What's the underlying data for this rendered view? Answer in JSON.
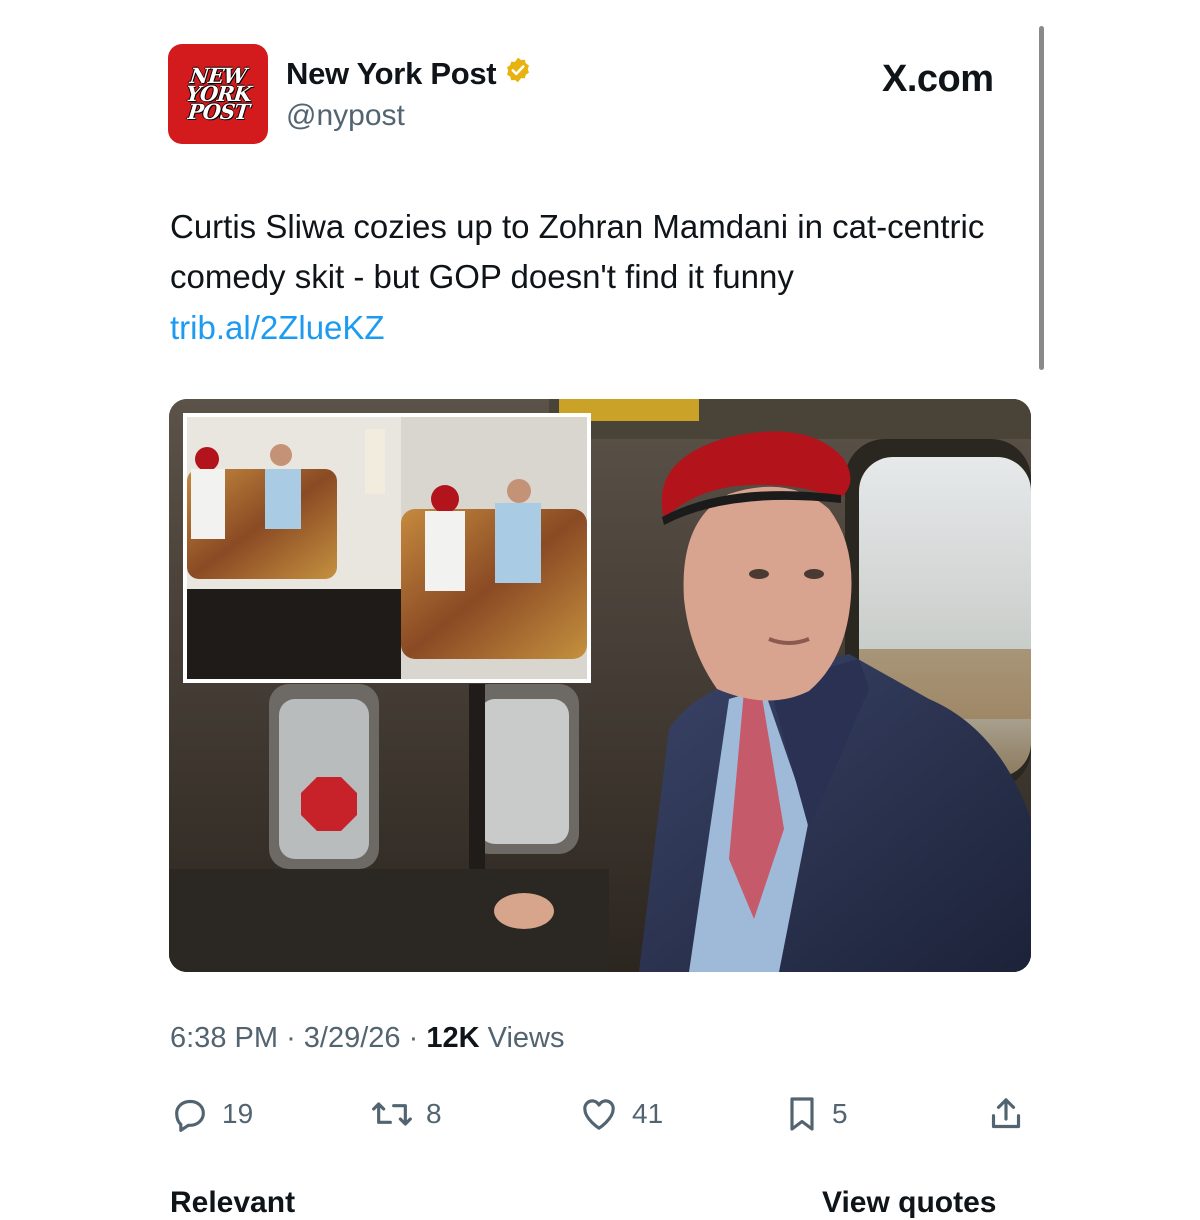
{
  "source_label": "X.com",
  "account": {
    "name": "New York Post",
    "handle": "@nypost",
    "avatar_lines": [
      "NEW",
      "YORK",
      "POST"
    ],
    "verified": true,
    "verified_color": "#e8b20f"
  },
  "tweet": {
    "text": "Curtis Sliwa cozies up to Zohran Mamdani in cat-centric comedy skit - but GOP doesn't find it funny",
    "link": "trib.al/2ZlueKZ"
  },
  "meta": {
    "time": "6:38 PM",
    "date": "3/29/26",
    "views_count": "12K",
    "views_label": "Views"
  },
  "actions": {
    "replies": "19",
    "reposts": "8",
    "likes": "41",
    "bookmarks": "5"
  },
  "footer": {
    "left_label": "Relevant",
    "right_label": "View quotes"
  },
  "colors": {
    "brand_red": "#d31a1c",
    "link_blue": "#1d9bf0",
    "muted": "#536471",
    "text": "#0f1419"
  }
}
